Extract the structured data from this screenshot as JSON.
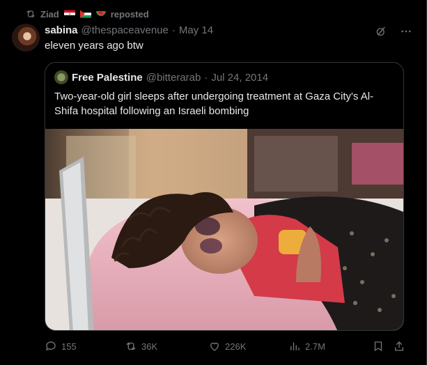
{
  "repost": {
    "user": "Ziad",
    "suffix": "reposted"
  },
  "post": {
    "display_name": "sabina",
    "handle": "@thespaceavenue",
    "separator": "·",
    "date": "May 14",
    "text": "eleven years ago btw"
  },
  "quote": {
    "display_name": "Free Palestine",
    "handle": "@bitterarab",
    "separator": "·",
    "date": "Jul 24, 2014",
    "text": "Two-year-old girl sleeps after undergoing treatment at Gaza City's Al-Shifa hospital following an Israeli bombing"
  },
  "actions": {
    "replies": "155",
    "reposts": "36K",
    "likes": "226K",
    "views": "2.7M"
  },
  "colors": {
    "background": "#000000",
    "text": "#e7e9ea",
    "muted": "#71767b",
    "border": "#333639"
  },
  "icons": [
    "repost-icon",
    "grok-icon",
    "more-icon",
    "reply-icon",
    "like-icon",
    "views-icon",
    "bookmark-icon",
    "share-icon"
  ]
}
